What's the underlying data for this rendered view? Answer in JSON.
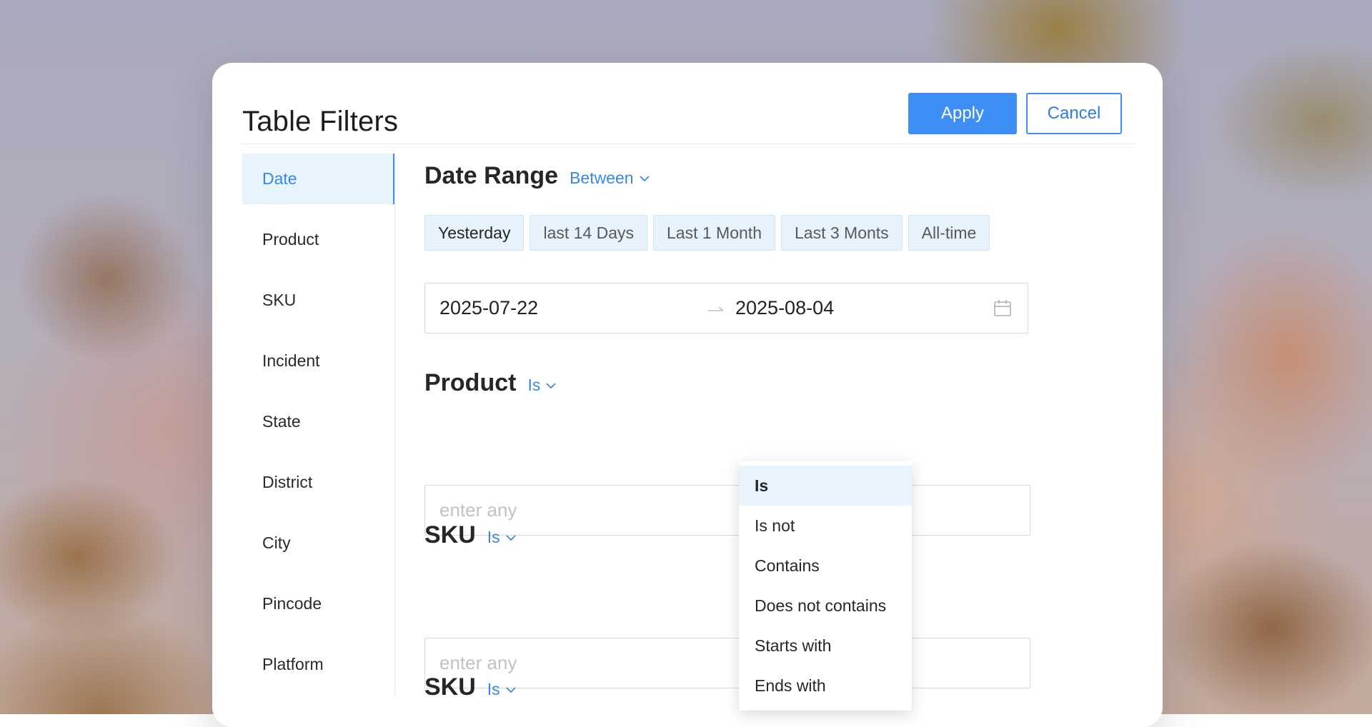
{
  "dialog": {
    "title": "Table Filters",
    "apply_label": "Apply",
    "cancel_label": "Cancel"
  },
  "sidebar": {
    "items": [
      {
        "label": "Date",
        "active": true
      },
      {
        "label": "Product"
      },
      {
        "label": "SKU"
      },
      {
        "label": "Incident"
      },
      {
        "label": "State"
      },
      {
        "label": "District"
      },
      {
        "label": "City"
      },
      {
        "label": "Pincode"
      },
      {
        "label": "Platform"
      }
    ]
  },
  "date_section": {
    "title": "Date Range",
    "operator": "Between",
    "quick_ranges": [
      "Yesterday",
      "last 14 Days",
      "Last 1 Month",
      "Last 3 Monts",
      "All-time"
    ],
    "selected_range": "Yesterday",
    "start_date": "2025-07-22",
    "end_date": "2025-08-04"
  },
  "product_section": {
    "title": "Product",
    "operator": "Is",
    "placeholder": "enter any"
  },
  "sku_section": {
    "title": "SKU",
    "operator": "Is",
    "placeholder": "enter any"
  },
  "sku_section_2": {
    "title": "SKU",
    "operator": "Is"
  },
  "operator_dropdown": {
    "options": [
      "Is",
      "Is not",
      "Contains",
      "Does not contains",
      "Starts with",
      "Ends with"
    ],
    "selected": "Is"
  },
  "colors": {
    "accent": "#3d8ff5",
    "accent_text": "#3a88e6",
    "selected_bg": "#e7f4fd"
  },
  "icons": {
    "operator_chevron": "chevron-down-icon",
    "date_separator": "arrow-right-icon",
    "date_picker": "calendar-icon"
  }
}
